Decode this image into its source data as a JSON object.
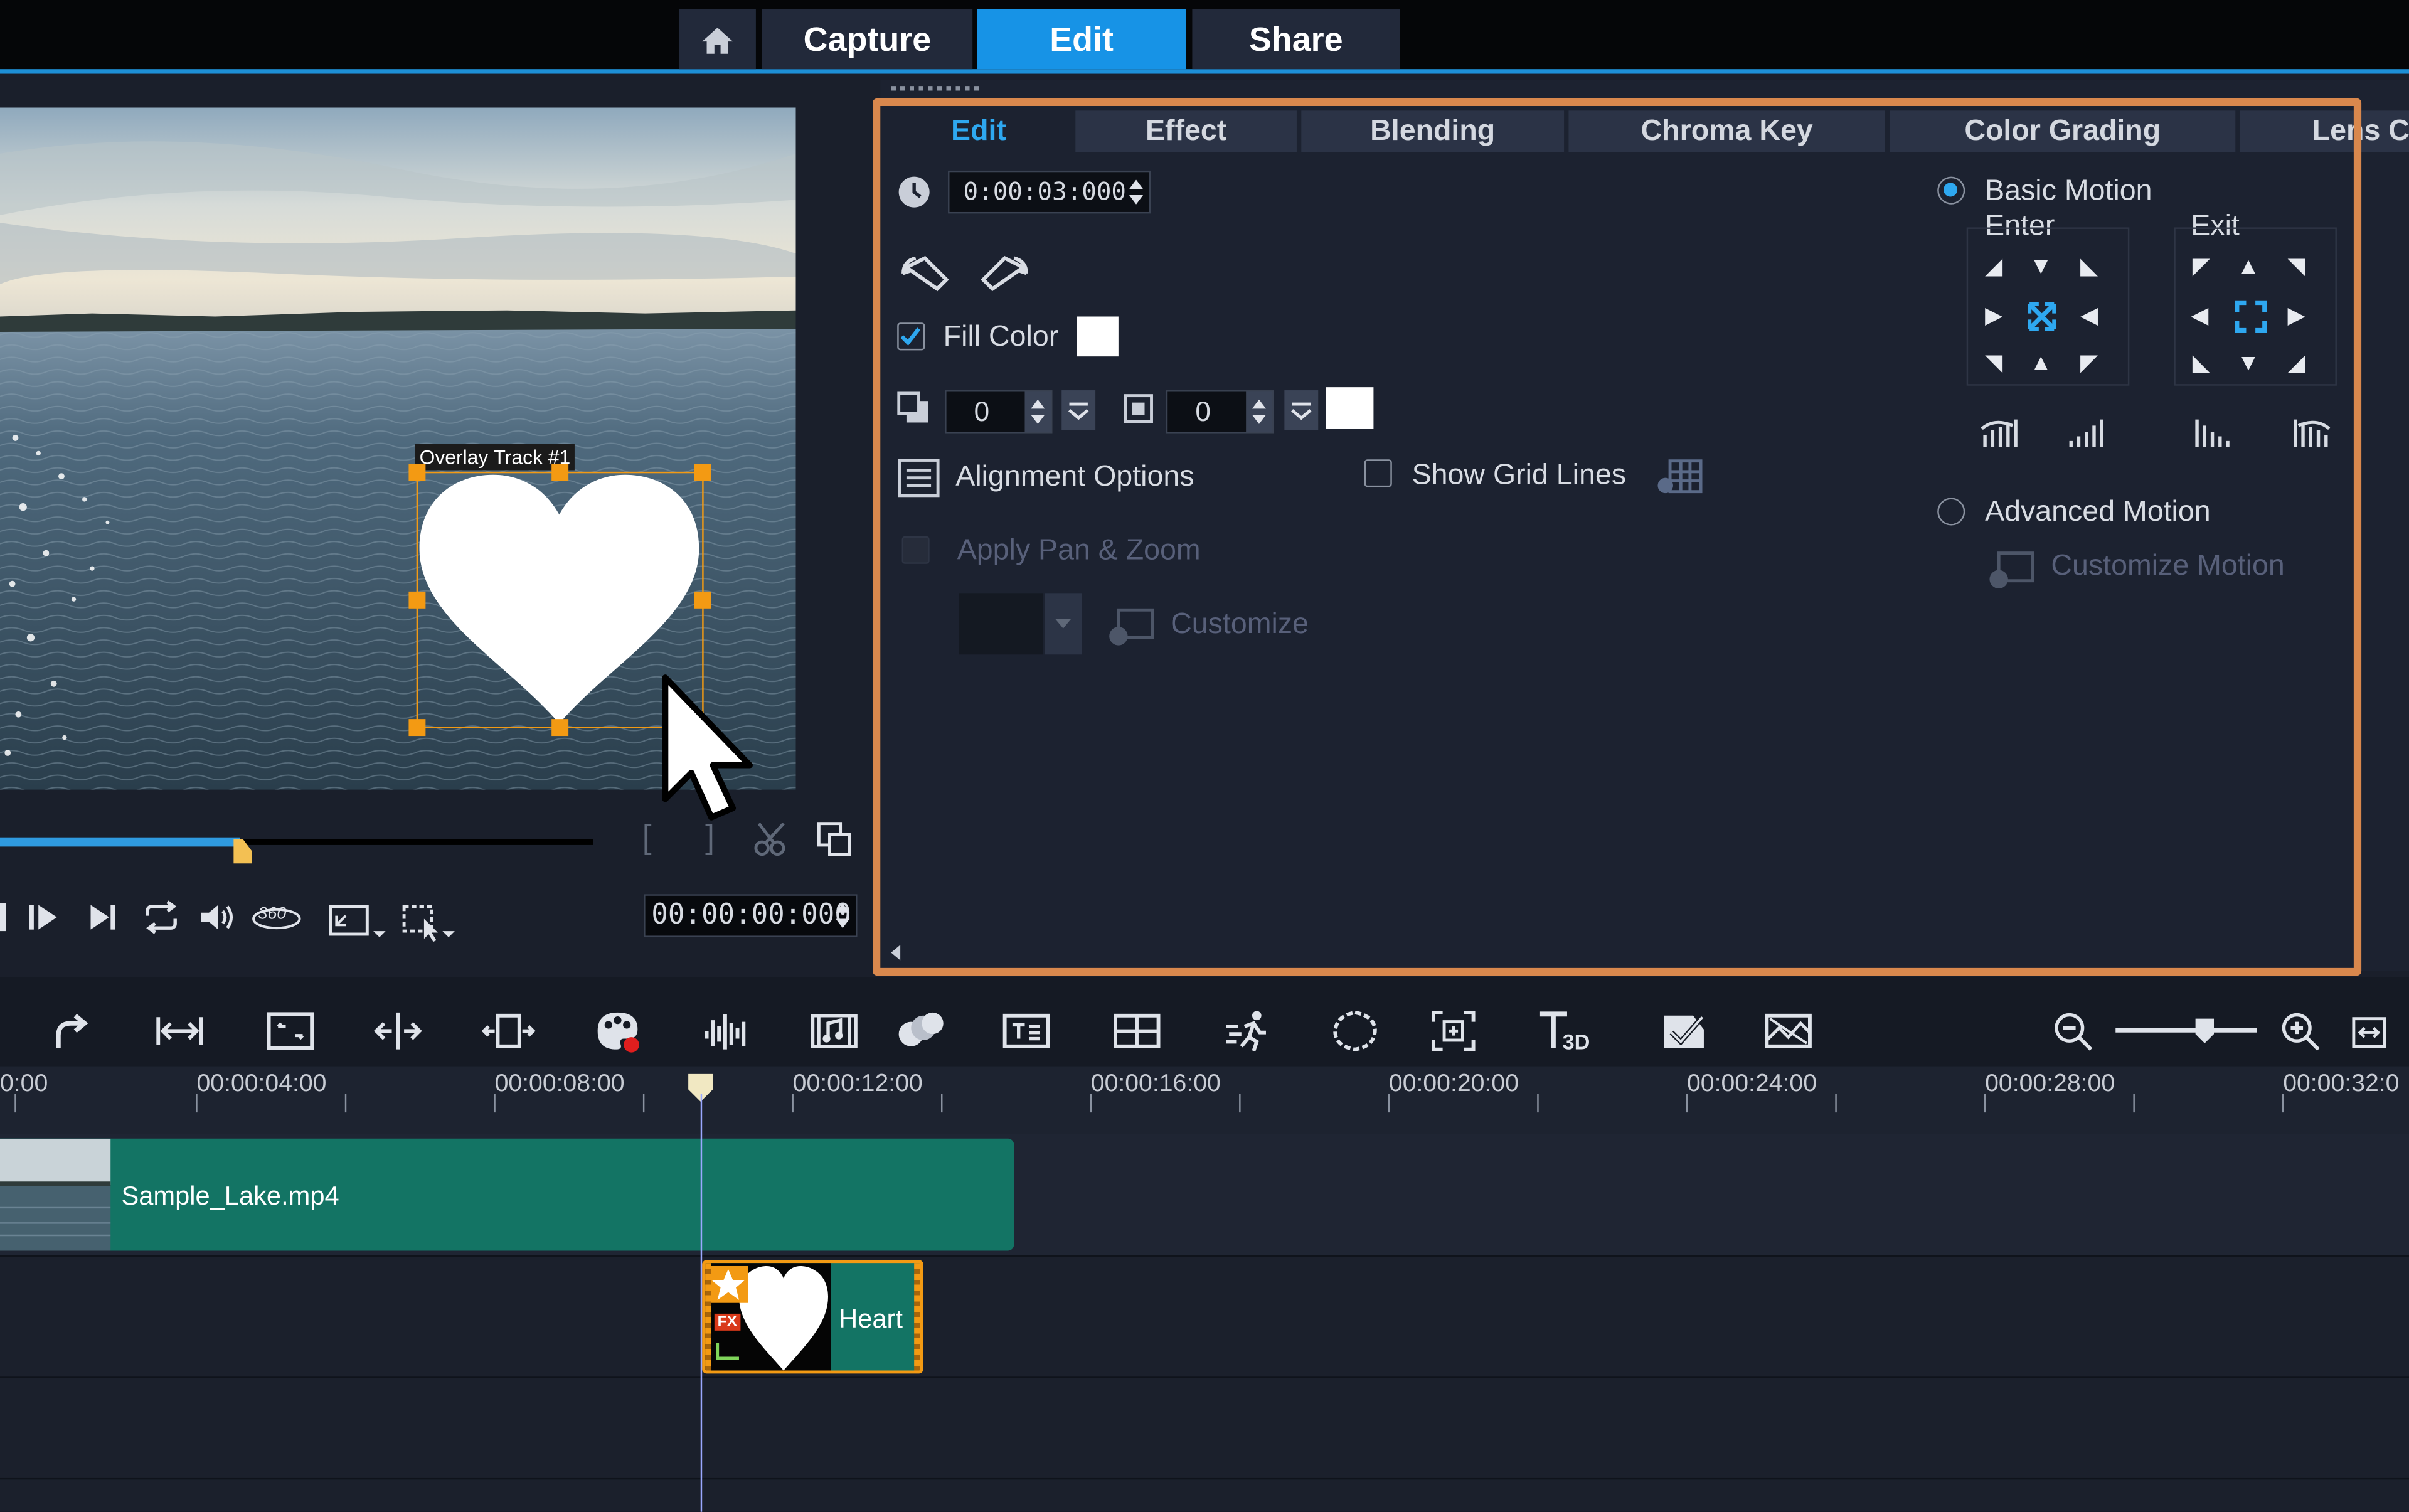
{
  "app": {
    "main_tabs": [
      {
        "label": "Capture"
      },
      {
        "label": "Edit"
      },
      {
        "label": "Share"
      }
    ]
  },
  "preview": {
    "overlay_label": "Overlay Track #1",
    "timecode": "00:00:00:000"
  },
  "options_panel": {
    "tabs": [
      {
        "label": "Edit"
      },
      {
        "label": "Effect"
      },
      {
        "label": "Blending"
      },
      {
        "label": "Chroma Key"
      },
      {
        "label": "Color Grading"
      },
      {
        "label": "Lens C"
      }
    ],
    "duration": "0:00:03:000",
    "fill_color_label": "Fill Color",
    "fill_color_checked": true,
    "fill_color_value": "#ffffff",
    "shadow_value": "0",
    "border_value": "0",
    "border_color_value": "#ffffff",
    "alignment_options_label": "Alignment Options",
    "show_grid_lines_label": "Show Grid Lines",
    "apply_pan_zoom_label": "Apply Pan & Zoom",
    "customize_label": "Customize",
    "basic_motion_label": "Basic Motion",
    "enter_label": "Enter",
    "exit_label": "Exit",
    "advanced_motion_label": "Advanced Motion",
    "customize_motion_label": "Customize Motion"
  },
  "timeline": {
    "ruler_ticks": [
      "0:00",
      "00:00:04:00",
      "00:00:08:00",
      "00:00:12:00",
      "00:00:16:00",
      "00:00:20:00",
      "00:00:24:00",
      "00:00:28:00",
      "00:00:32:0"
    ],
    "video_clip_name": "Sample_Lake.mp4",
    "overlay_clip_name": "Heart",
    "overlay_clip_badge": "FX"
  },
  "colors": {
    "accent": "#1793e6",
    "highlight_border": "#d9884d",
    "selection": "#f39a13",
    "clip": "#137464"
  }
}
